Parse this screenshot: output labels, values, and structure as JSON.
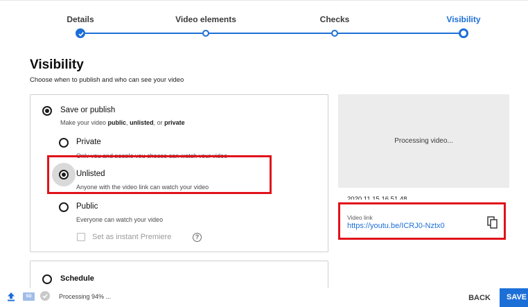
{
  "stepper": {
    "steps": [
      {
        "label": "Details",
        "state": "done"
      },
      {
        "label": "Video elements",
        "state": "done"
      },
      {
        "label": "Checks",
        "state": "done"
      },
      {
        "label": "Visibility",
        "state": "current"
      }
    ]
  },
  "page": {
    "title": "Visibility",
    "subtitle": "Choose when to publish and who can see your video"
  },
  "save_or_publish": {
    "label": "Save or publish",
    "desc_prefix": "Make your video ",
    "desc_public": "public",
    "desc_sep": ", ",
    "desc_unlisted": "unlisted",
    "desc_or": ", or ",
    "desc_private": "private",
    "selected": true
  },
  "options": {
    "private": {
      "label": "Private",
      "desc": "Only you and people you choose can watch your video",
      "selected": false
    },
    "unlisted": {
      "label": "Unlisted",
      "desc": "Anyone with the video link can watch your video",
      "selected": true
    },
    "public": {
      "label": "Public",
      "desc": "Everyone can watch your video",
      "selected": false
    },
    "premiere": {
      "label": "Set as instant Premiere",
      "help": "?",
      "checked": false
    }
  },
  "schedule": {
    "label": "Schedule",
    "selected": false
  },
  "preview": {
    "status": "Processing video...",
    "file_name": "2020 11 15 16 51 48",
    "link_label": "Video link",
    "link_url": "https://youtu.be/ICRJ0-Nztx0"
  },
  "footer": {
    "sd_label": "SD",
    "processing_text": "Processing 94% ...",
    "back_label": "BACK",
    "save_label": "SAVE"
  },
  "colors": {
    "accent": "#1d6fd8",
    "highlight": "#e0121a"
  },
  "icons": [
    "check-icon",
    "help-icon",
    "copy-icon",
    "upload-icon",
    "sd-badge-icon"
  ]
}
